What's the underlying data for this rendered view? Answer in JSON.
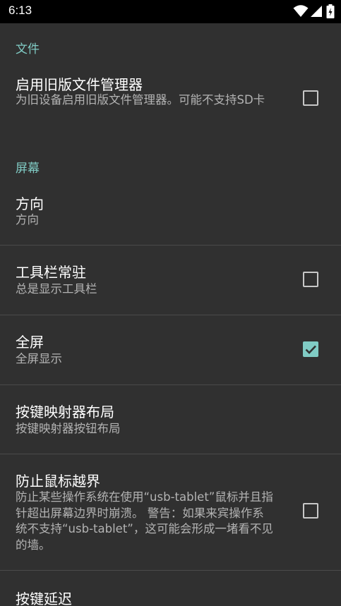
{
  "status_bar": {
    "time": "6:13",
    "icons": [
      "wifi-icon",
      "cell-signal-icon",
      "battery-charging-icon"
    ]
  },
  "colors": {
    "background": "#303030",
    "accent": "#80cbc4",
    "title": "#ffffff",
    "summary": "#b3b3b3",
    "divider": "#4a4a4a"
  },
  "categories": {
    "files": "文件",
    "screen": "屏幕"
  },
  "prefs": {
    "legacy_file_manager": {
      "title": "启用旧版文件管理器",
      "summary": "为旧设备启用旧版文件管理器。可能不支持SD卡",
      "checked": false
    },
    "orientation": {
      "title": "方向",
      "summary": "方向"
    },
    "toolbar_always": {
      "title": "工具栏常驻",
      "summary": "总是显示工具栏",
      "checked": false
    },
    "fullscreen": {
      "title": "全屏",
      "summary": "全屏显示",
      "checked": true
    },
    "key_mapper_layout": {
      "title": "按键映射器布局",
      "summary": "按键映射器按钮布局"
    },
    "prevent_mouse_out": {
      "title": "防止鼠标越界",
      "summary": "防止某些操作系统在使用“usb-tablet”鼠标并且指针超出屏幕边界时崩溃。 警告：如果来宾操作系统不支持“usb-tablet”，这可能会形成一堵看不见的墙。",
      "checked": false
    },
    "key_delay": {
      "title": "按键延迟"
    }
  }
}
